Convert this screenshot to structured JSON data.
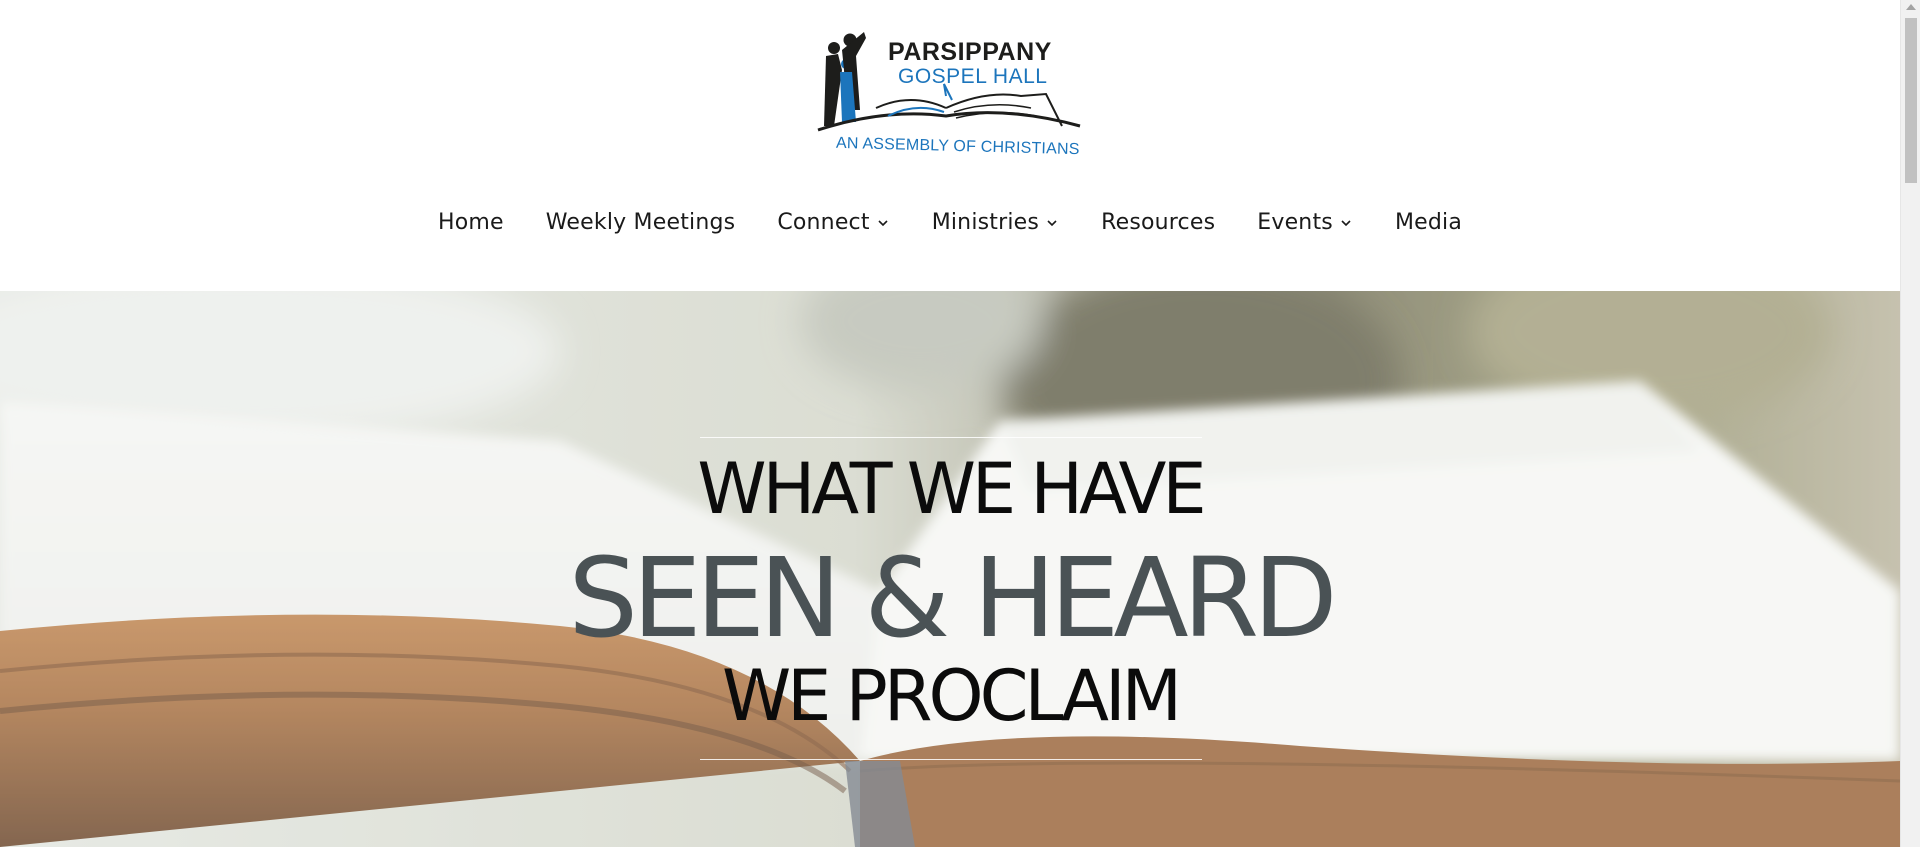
{
  "logo": {
    "line1": "PARSIPPANY",
    "line2": "GOSPEL HALL",
    "tagline": "AN ASSEMBLY OF CHRISTIANS",
    "colors": {
      "dark": "#1d1d1b",
      "blue": "#1c75bc"
    }
  },
  "nav": {
    "items": [
      {
        "label": "Home",
        "has_dropdown": false
      },
      {
        "label": "Weekly Meetings",
        "has_dropdown": false
      },
      {
        "label": "Connect",
        "has_dropdown": true
      },
      {
        "label": "Ministries",
        "has_dropdown": true
      },
      {
        "label": "Resources",
        "has_dropdown": false
      },
      {
        "label": "Events",
        "has_dropdown": true
      },
      {
        "label": "Media",
        "has_dropdown": false
      }
    ],
    "dropdown_icon": "chevron-down-icon"
  },
  "hero": {
    "line1": "WHAT WE HAVE",
    "line2": "SEEN & HEARD",
    "line3": "WE PROCLAIM",
    "background": "open-book-photo",
    "colors": {
      "primary_text": "#0b0b0b",
      "accent_text": "#4a5255"
    }
  }
}
